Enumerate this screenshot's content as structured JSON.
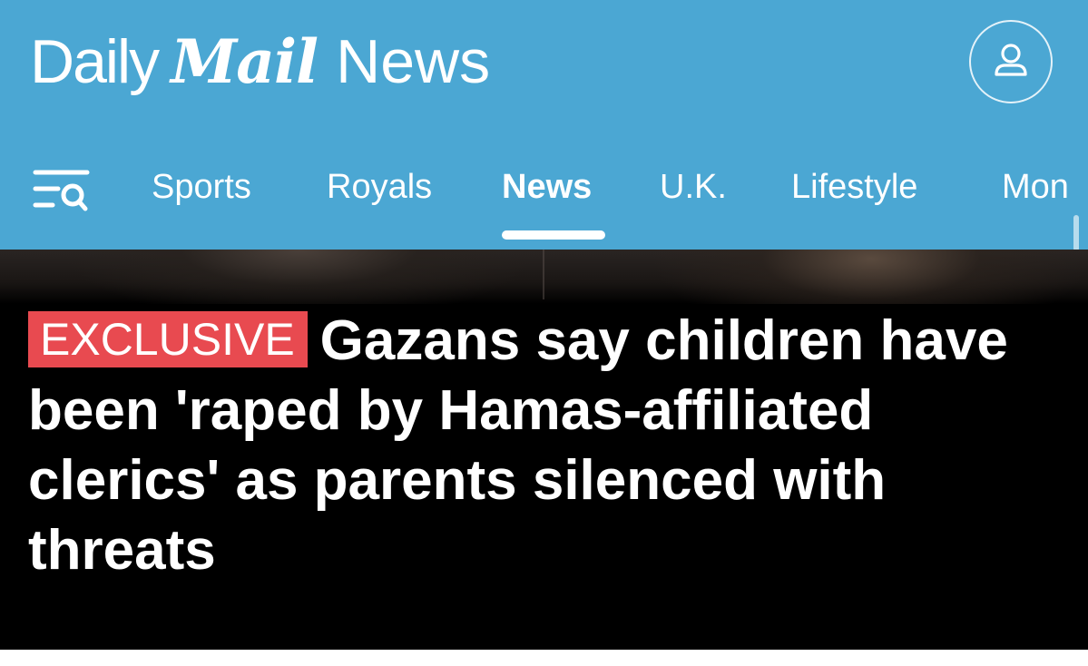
{
  "brand": {
    "daily": "Daily",
    "mail": "Mail",
    "news": "News"
  },
  "account": {
    "icon": "user-icon"
  },
  "nav": {
    "menu_icon": "menu-search-icon",
    "items": [
      {
        "label": "Sports"
      },
      {
        "label": "Royals"
      },
      {
        "label": "News"
      },
      {
        "label": "U.K."
      },
      {
        "label": "Lifestyle"
      },
      {
        "label": "Mon"
      }
    ],
    "active": "News"
  },
  "article": {
    "badge": "EXCLUSIVE",
    "headline": "Gazans say children have been 'raped by Hamas-affiliated clerics' as parents silenced with threats"
  },
  "colors": {
    "header_bg": "#4ba7d3",
    "badge_bg": "#e84a50",
    "hero_bg": "#000000",
    "text_light": "#ffffff"
  }
}
